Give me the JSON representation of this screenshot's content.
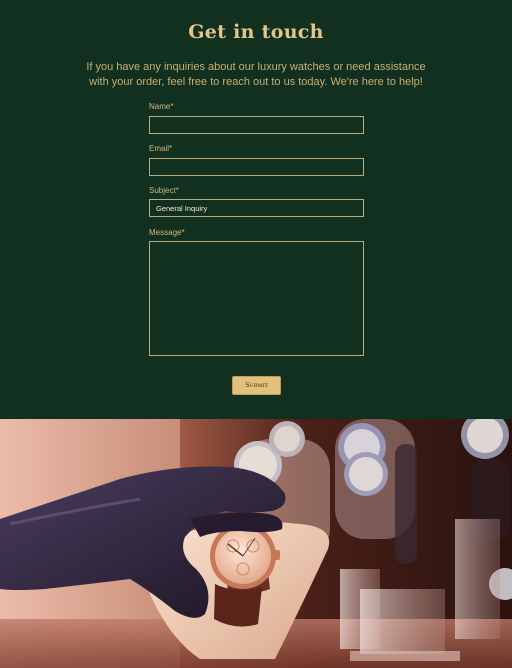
{
  "contact": {
    "title": "Get in touch",
    "intro": "If you have any inquiries about our luxury watches or need assistance with your order, feel free to reach out to us today. We're here to help!",
    "fields": {
      "name_label": "Name*",
      "name_value": "",
      "email_label": "Email*",
      "email_value": "",
      "subject_label": "Subject*",
      "subject_value": "General Inquiry",
      "message_label": "Message*",
      "message_value": ""
    },
    "submit_label": "Submit"
  },
  "hero": {
    "image_subject": "gloved-hand-holding-rose-gold-watch-in-display"
  },
  "colors": {
    "background": "#12301f",
    "accent": "#e3c07c",
    "text": "#c8ae72",
    "input_border": "#b9ad7c"
  }
}
